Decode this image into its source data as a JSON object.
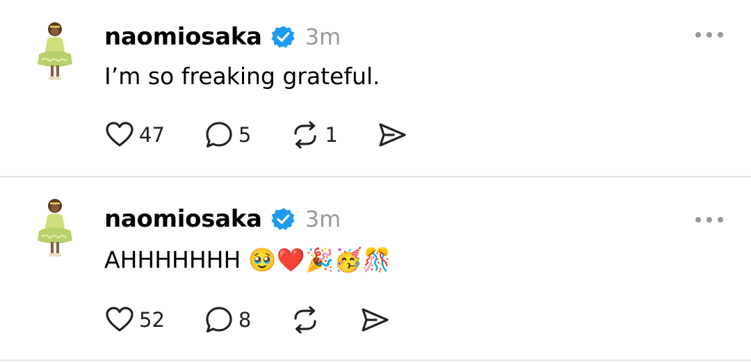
{
  "posts": [
    {
      "username": "naomiosaka",
      "time": "3m",
      "text": "I’m so freaking grateful.",
      "likes": "47",
      "replies": "5",
      "reposts": "1"
    },
    {
      "username": "naomiosaka",
      "time": "3m",
      "text": "AHHHHHHH 🥹❤️🎉🥳🎊",
      "likes": "52",
      "replies": "8",
      "reposts": ""
    }
  ],
  "icons": {
    "verified": "verified-badge-icon",
    "like": "heart-icon",
    "reply": "comment-icon",
    "repost": "repost-icon",
    "share": "send-icon",
    "more": "more-options-icon"
  },
  "colors": {
    "verified": "#1d9bf0",
    "muted": "#999999"
  }
}
